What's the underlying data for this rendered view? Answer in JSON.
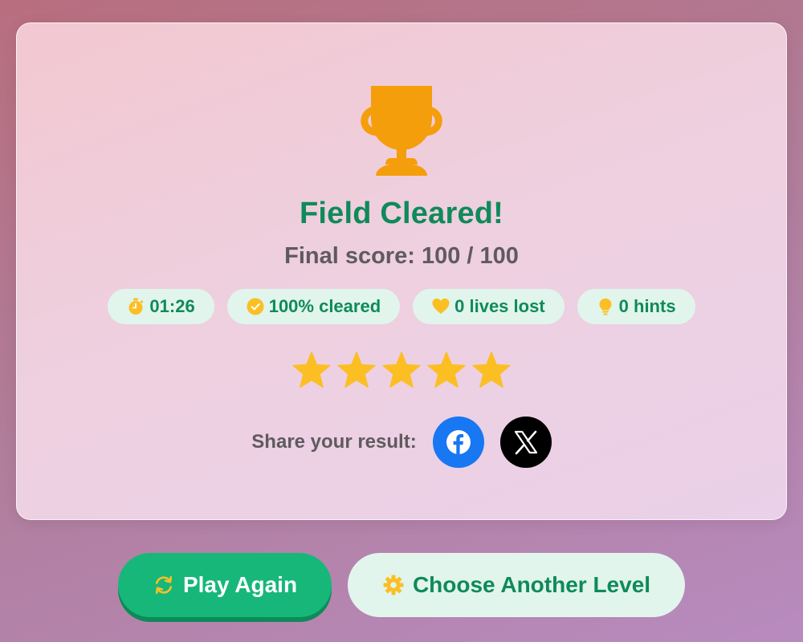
{
  "colors": {
    "accent_green": "#0f8a5a",
    "play_button": "#17b77a",
    "play_button_shadow": "#0e8a58",
    "pill_bg": "#e1f5ec",
    "trophy": "#f59e0b",
    "star": "#fbbf24",
    "facebook": "#1877f2",
    "x": "#000000"
  },
  "result": {
    "icon": "trophy-icon",
    "title": "Field Cleared!",
    "score_text": "Final score: 100 / 100"
  },
  "stats": [
    {
      "icon": "stopwatch-icon",
      "text": "01:26"
    },
    {
      "icon": "check-circle-icon",
      "text": "100% cleared"
    },
    {
      "icon": "heart-icon",
      "text": "0 lives lost"
    },
    {
      "icon": "lightbulb-icon",
      "text": "0 hints"
    }
  ],
  "rating": {
    "stars": 5,
    "max": 5
  },
  "share": {
    "label": "Share your result:",
    "networks": [
      {
        "name": "Facebook",
        "icon": "facebook-icon"
      },
      {
        "name": "X",
        "icon": "x-icon"
      }
    ]
  },
  "buttons": {
    "play_again": {
      "label": "Play Again",
      "icon": "refresh-icon"
    },
    "choose_level": {
      "label": "Choose Another Level",
      "icon": "gear-icon"
    }
  }
}
